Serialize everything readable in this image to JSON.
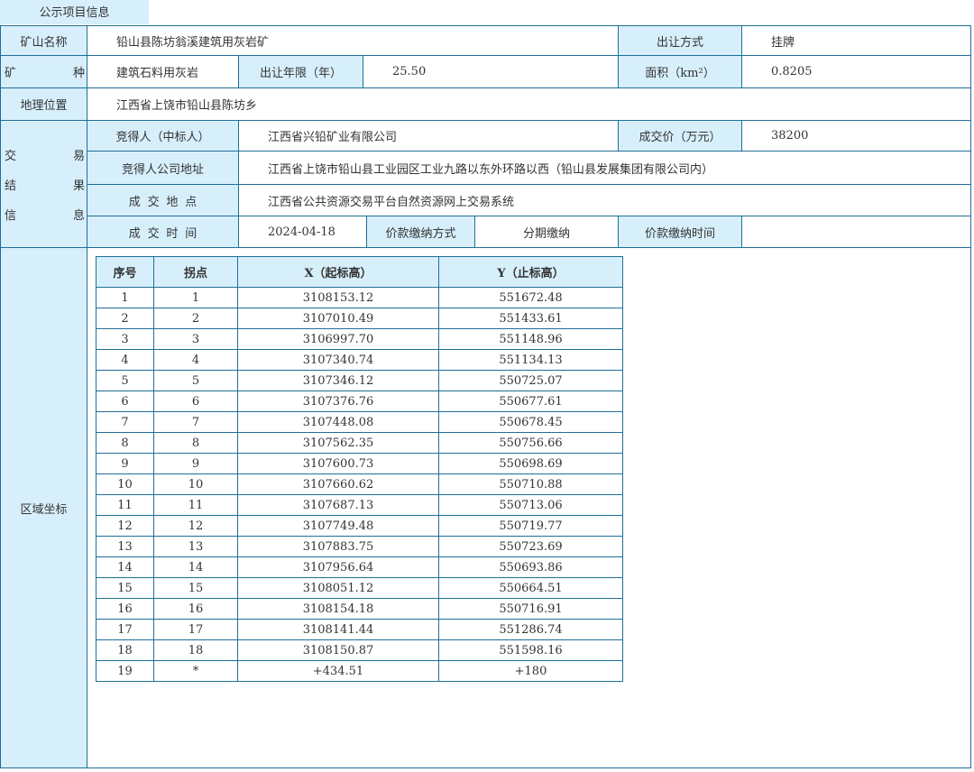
{
  "tab": {
    "label": "公示项目信息"
  },
  "mine_name_label": "矿山名称",
  "mine_name": "铅山县陈坊翁溪建筑用灰岩矿",
  "transfer_method_label": "出让方式",
  "transfer_method": "挂牌",
  "mineral_label": [
    "矿",
    "种"
  ],
  "mineral": "建筑石料用灰岩",
  "term_label": "出让年限（年）",
  "term": "25.50",
  "area_label": "面积（km²）",
  "area": "0.8205",
  "location_label": "地理位置",
  "location": "江西省上饶市铅山县陈坊乡",
  "deal_group_label": [
    [
      "交",
      "易"
    ],
    [
      "结",
      "果"
    ],
    [
      "信",
      "息"
    ]
  ],
  "winner_label": "竞得人（中标人）",
  "winner": "江西省兴铅矿业有限公司",
  "price_label": "成交价（万元）",
  "price": "38200",
  "winner_address_label": "竞得人公司地址",
  "winner_address": "江西省上饶市铅山县工业园区工业九路以东外环路以西（铅山县发展集团有限公司内）",
  "deal_place_label": "成交地点",
  "deal_place": "江西省公共资源交易平台自然资源网上交易系统",
  "deal_time_label": "成交时间",
  "deal_time": "2024-04-18",
  "payment_method_label": "价款缴纳方式",
  "payment_method": "分期缴纳",
  "payment_time_label": "价款缴纳时间",
  "payment_time": "",
  "coords_label": "区域坐标",
  "coords": {
    "headers": [
      "序号",
      "拐点",
      "X（起标高）",
      "Y（止标高）"
    ],
    "rows": [
      [
        "1",
        "1",
        "3108153.12",
        "551672.48"
      ],
      [
        "2",
        "2",
        "3107010.49",
        "551433.61"
      ],
      [
        "3",
        "3",
        "3106997.70",
        "551148.96"
      ],
      [
        "4",
        "4",
        "3107340.74",
        "551134.13"
      ],
      [
        "5",
        "5",
        "3107346.12",
        "550725.07"
      ],
      [
        "6",
        "6",
        "3107376.76",
        "550677.61"
      ],
      [
        "7",
        "7",
        "3107448.08",
        "550678.45"
      ],
      [
        "8",
        "8",
        "3107562.35",
        "550756.66"
      ],
      [
        "9",
        "9",
        "3107600.73",
        "550698.69"
      ],
      [
        "10",
        "10",
        "3107660.62",
        "550710.88"
      ],
      [
        "11",
        "11",
        "3107687.13",
        "550713.06"
      ],
      [
        "12",
        "12",
        "3107749.48",
        "550719.77"
      ],
      [
        "13",
        "13",
        "3107883.75",
        "550723.69"
      ],
      [
        "14",
        "14",
        "3107956.64",
        "550693.86"
      ],
      [
        "15",
        "15",
        "3108051.12",
        "550664.51"
      ],
      [
        "16",
        "16",
        "3108154.18",
        "550716.91"
      ],
      [
        "17",
        "17",
        "3108141.44",
        "551286.74"
      ],
      [
        "18",
        "18",
        "3108150.87",
        "551598.16"
      ],
      [
        "19",
        "*",
        "+434.51",
        "+180"
      ]
    ]
  }
}
